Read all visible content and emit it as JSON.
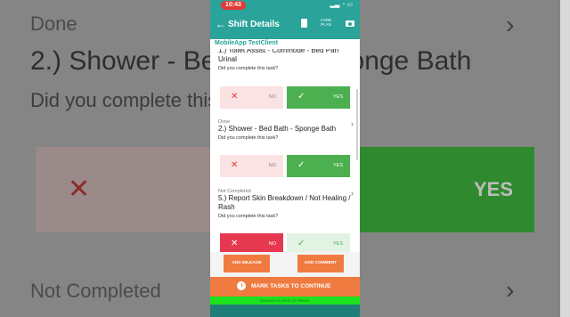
{
  "background": {
    "done_label": "Done",
    "task_text": "2.) Shower - Bed Bath - Sponge Bath",
    "question": "Did you complete this task?",
    "yes_label": "YES",
    "not_completed_label": "Not Completed"
  },
  "status_bar": {
    "time": "10:43",
    "icons": "▂▃ ◔ ▭"
  },
  "app_bar": {
    "title": "Shift Details",
    "care_plan": "CARE PLAN"
  },
  "client_name": "MobileApp TestClient",
  "tasks": [
    {
      "status": "",
      "name": "1.) Toilet Assist - Commode - Bed Pan Urinal",
      "question": "Did you complete this task?",
      "no_label": "NO",
      "yes_label": "YES",
      "selected": "yes"
    },
    {
      "status": "Done",
      "name": "2.) Shower - Bed Bath - Sponge Bath",
      "question": "Did you complete this task?",
      "no_label": "NO",
      "yes_label": "YES",
      "selected": "yes"
    },
    {
      "status": "Not Completed",
      "name": "5.) Report Skin Breakdown / Not Healing / Rash",
      "question": "Did you complete this task?",
      "no_label": "NO",
      "yes_label": "YES",
      "selected": "no"
    }
  ],
  "actions": {
    "add_mileage": "ADD MILEAGE",
    "add_comment": "ADD COMMENT"
  },
  "mark_tasks": "MARK TASKS TO CONTINUE",
  "distance": "Distance to client 21 Meters",
  "colors": {
    "primary": "#2aa39a",
    "accent": "#f07b41",
    "yes": "#4caf50",
    "no": "#e53950"
  }
}
